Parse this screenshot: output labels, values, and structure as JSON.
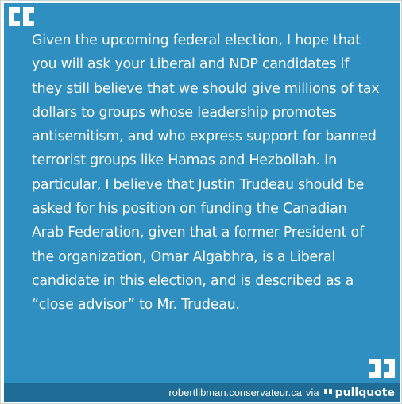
{
  "quote": {
    "text": "Given the upcoming federal election, I hope that you will ask your Liberal and NDP candidates if they still believe that we should give millions of tax dollars to groups whose leadership promotes antisemitism, and who express support for banned terrorist groups like Hamas and Hezbollah. In particular, I believe that Justin Trudeau should be asked for his position on funding the Canadian Arab Federation, given that a former President of the organization, Omar Algabhra, is a Liberal candidate in this election, and is described as a “close advisor” to Mr. Trudeau."
  },
  "footer": {
    "source": "robertlibman.conservateur.ca",
    "via": "via",
    "brand": "pullquote"
  },
  "colors": {
    "panel": "#2e8fc0",
    "footer": "#1f6d96",
    "quote_marks": "#ffffff"
  },
  "icons": {
    "open": "open-quote-icon",
    "close": "close-quote-icon",
    "brand": "pullquote-logo-icon"
  }
}
